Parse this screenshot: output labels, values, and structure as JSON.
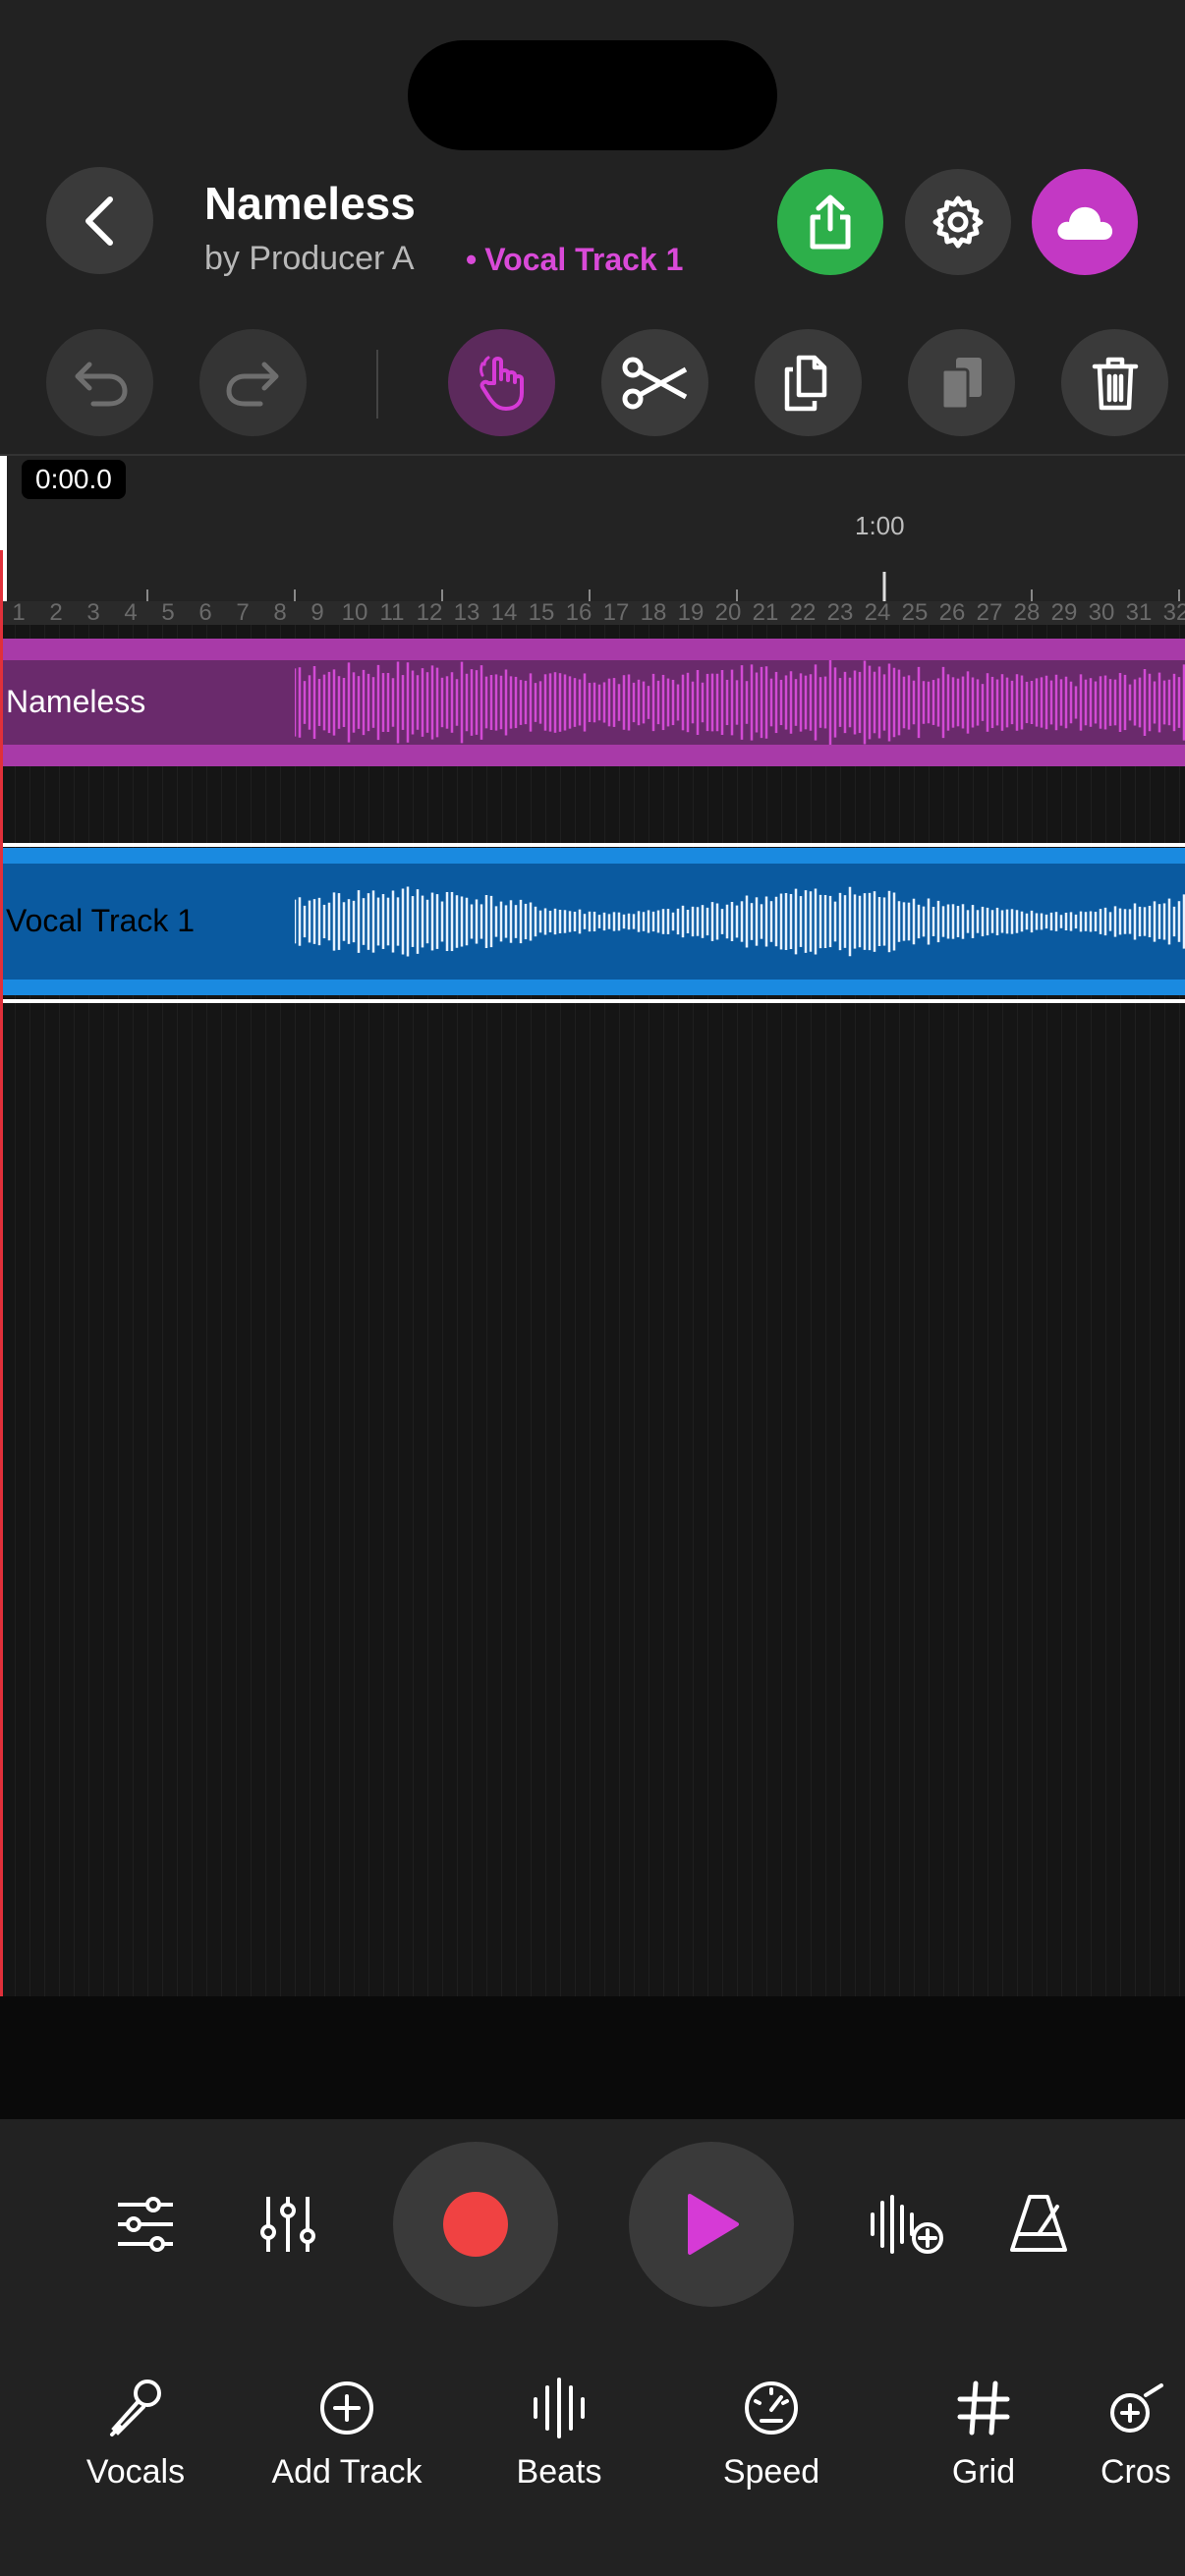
{
  "header": {
    "title": "Nameless",
    "subtitle": "by Producer A",
    "active_track_dot": "•",
    "active_track": "Vocal Track 1"
  },
  "timeline": {
    "current_time": "0:00.0",
    "minute_marker": "1:00",
    "bar_numbers": [
      "1",
      "2",
      "3",
      "4",
      "5",
      "6",
      "7",
      "8",
      "9",
      "10",
      "11",
      "12",
      "13",
      "14",
      "15",
      "16",
      "17",
      "18",
      "19",
      "20",
      "21",
      "22",
      "23",
      "24",
      "25",
      "26",
      "27",
      "28",
      "29",
      "30",
      "31",
      "32"
    ],
    "tracks": [
      {
        "name": "Nameless",
        "color": "#6a2a6c",
        "wave_color": "#d24ad4"
      },
      {
        "name": "Vocal Track 1",
        "color": "#0a5aa0",
        "wave_color": "#e6f1ff"
      }
    ]
  },
  "colors": {
    "accent": "#c338c4",
    "share_green": "#2daf4a",
    "record_red": "#f04242",
    "play_magenta": "#d63ad6",
    "playhead_red": "#e0303a"
  },
  "bottom_nav": [
    {
      "label": "Vocals",
      "icon": "microphone-icon"
    },
    {
      "label": "Add Track",
      "icon": "plus-circle-icon"
    },
    {
      "label": "Beats",
      "icon": "waveform-icon"
    },
    {
      "label": "Speed",
      "icon": "gauge-icon"
    },
    {
      "label": "Grid",
      "icon": "hash-icon"
    },
    {
      "label": "Cros",
      "icon": "crossfade-icon"
    }
  ]
}
